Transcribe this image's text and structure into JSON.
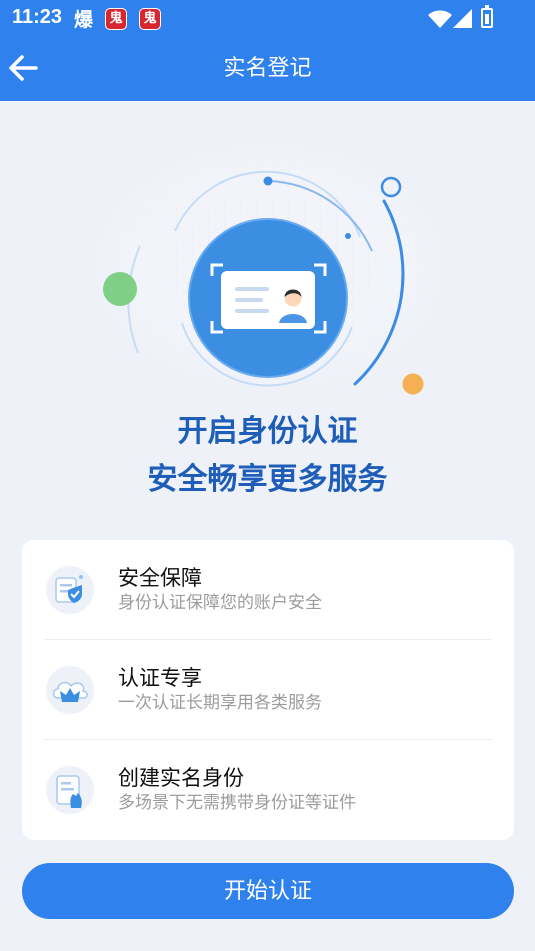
{
  "status": {
    "time": "11:23",
    "note": "爆",
    "badge1": "鬼",
    "badge2": "鬼"
  },
  "nav": {
    "title": "实名登记"
  },
  "hero": {
    "line1": "开启身份认证",
    "line2": "安全畅享更多服务"
  },
  "features": [
    {
      "title": "安全保障",
      "desc": "身份认证保障您的账户安全",
      "icon": "shield-document-icon"
    },
    {
      "title": "认证专享",
      "desc": "一次认证长期享用各类服务",
      "icon": "crown-cloud-icon"
    },
    {
      "title": "创建实名身份",
      "desc": "多场景下无需携带身份证等证件",
      "icon": "id-card-hand-icon"
    }
  ],
  "action": {
    "label": "开始认证"
  },
  "colors": {
    "primary": "#2f82ee",
    "background": "#eef1f8",
    "hero_text": "#1e5db8"
  }
}
